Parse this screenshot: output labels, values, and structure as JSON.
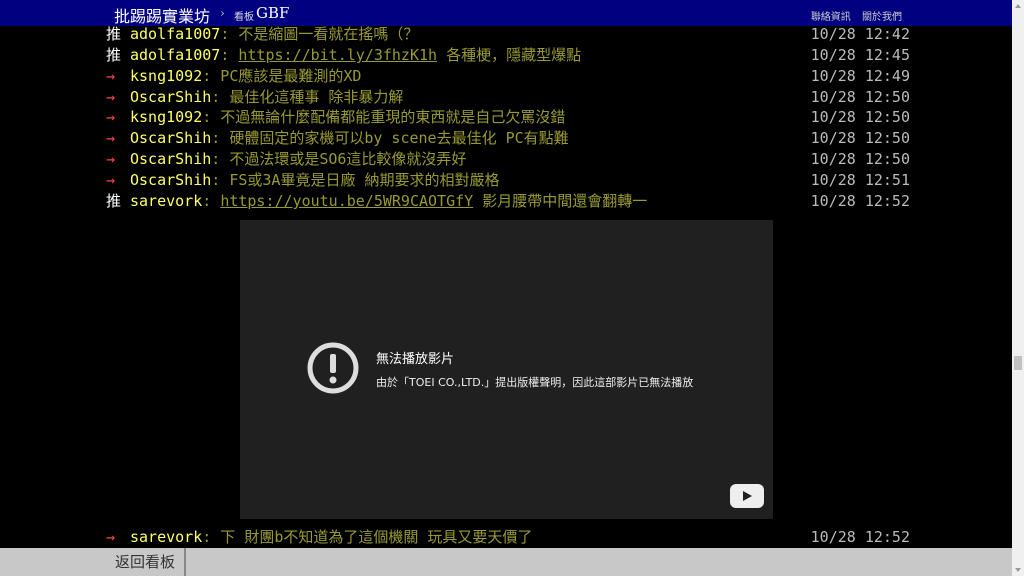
{
  "header": {
    "site_title": "批踢踢實業坊",
    "separator": "›",
    "board_label": "看板",
    "board_name": "GBF",
    "links": [
      "聯絡資訊",
      "關於我們"
    ]
  },
  "pushes": [
    {
      "tag": "推",
      "user": "adolfa1007",
      "content": ": 不是縮圖一看就在搖嗎（？",
      "link": "",
      "content_after": "",
      "time": "10/28 12:42"
    },
    {
      "tag": "推",
      "user": "adolfa1007",
      "content": ": ",
      "link": "https://bit.ly/3fhzK1h",
      "content_after": " 各種梗，隱藏型爆點",
      "time": "10/28 12:45"
    },
    {
      "tag": "→",
      "user": "ksng1092",
      "content": ": PC應該是最難測的XD",
      "link": "",
      "content_after": "",
      "time": "10/28 12:49"
    },
    {
      "tag": "→",
      "user": "OscarShih",
      "content": ": 最佳化這種事 除非暴力解",
      "link": "",
      "content_after": "",
      "time": "10/28 12:50"
    },
    {
      "tag": "→",
      "user": "ksng1092",
      "content": ": 不過無論什麼配備都能重現的東西就是自己欠罵沒錯",
      "link": "",
      "content_after": "",
      "time": "10/28 12:50"
    },
    {
      "tag": "→",
      "user": "OscarShih",
      "content": ": 硬體固定的家機可以by scene去最佳化 PC有點難",
      "link": "",
      "content_after": "",
      "time": "10/28 12:50"
    },
    {
      "tag": "→",
      "user": "OscarShih",
      "content": ": 不過法環或是SO6這比較像就沒弄好",
      "link": "",
      "content_after": "",
      "time": "10/28 12:50"
    },
    {
      "tag": "→",
      "user": "OscarShih",
      "content": ": FS或3A畢竟是日廠 納期要求的相對嚴格",
      "link": "",
      "content_after": "",
      "time": "10/28 12:51"
    },
    {
      "tag": "推",
      "user": "sarevork",
      "content": ": ",
      "link": "https://youtu.be/5WR9CAOTGfY",
      "content_after": " 影月腰帶中間還會翻轉一",
      "time": "10/28 12:52"
    },
    {
      "tag": "→",
      "user": "sarevork",
      "content": ": 下 財團b不知道為了這個機關 玩具又要天價了",
      "link": "",
      "content_after": "",
      "time": "10/28 12:52"
    }
  ],
  "video": {
    "error_title": "無法播放影片",
    "error_desc": "由於「TOEI CO.,LTD.」提出版權聲明，因此這部影片已無法播放",
    "error_icon": "alert-circle-icon",
    "logo_icon": "youtube-icon"
  },
  "footer": {
    "back_label": "返回看板"
  },
  "colors": {
    "topbar": "#000080",
    "user": "#ffff66",
    "content": "#999933",
    "arrow": "#ff4444"
  }
}
